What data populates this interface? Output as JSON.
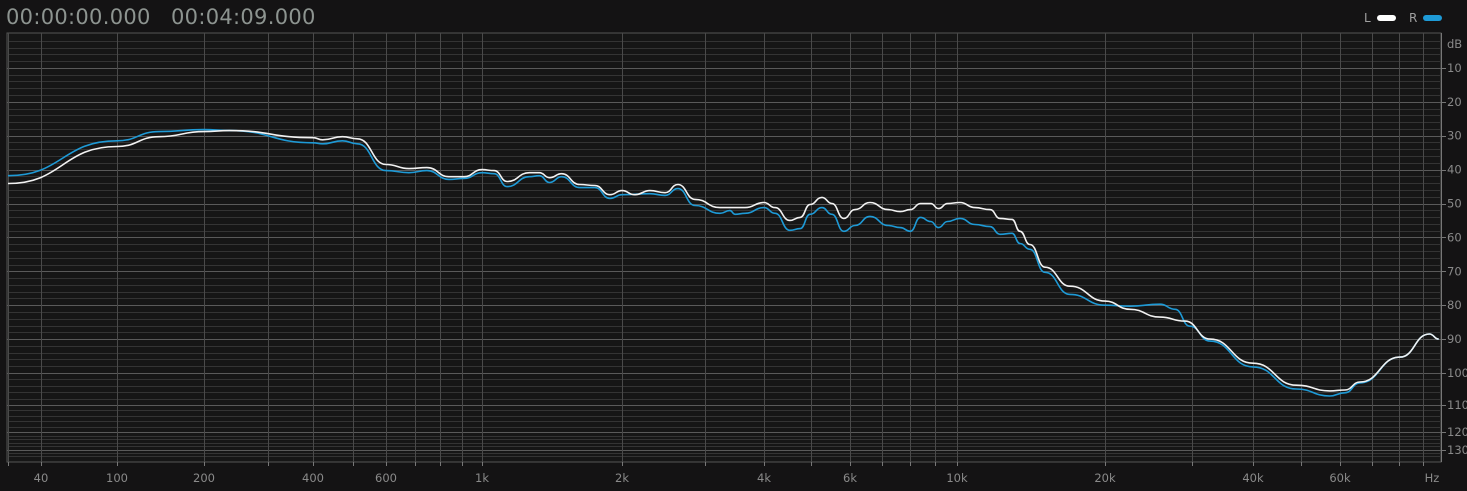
{
  "header": {
    "start_time": "00:00:00.000",
    "end_time": "00:04:09.000"
  },
  "legend": [
    {
      "label": "L",
      "color": "#ffffff"
    },
    {
      "label": "R",
      "color": "#1e9ad6"
    }
  ],
  "chart_data": {
    "type": "line",
    "title": "",
    "xlabel": "Hz",
    "ylabel": "dB",
    "xscale": "log",
    "xlim": [
      20,
      100000
    ],
    "ylim": [
      0,
      135
    ],
    "y_inverted": true,
    "grid": true,
    "legend_position": "top-right",
    "x_ticks": [
      {
        "value": 40,
        "label": "40"
      },
      {
        "value": 100,
        "label": "100"
      },
      {
        "value": 200,
        "label": "200"
      },
      {
        "value": 400,
        "label": "400"
      },
      {
        "value": 600,
        "label": "600"
      },
      {
        "value": 1000,
        "label": "1k"
      },
      {
        "value": 2000,
        "label": "2k"
      },
      {
        "value": 4000,
        "label": "4k"
      },
      {
        "value": 6000,
        "label": "6k"
      },
      {
        "value": 10000,
        "label": "10k"
      },
      {
        "value": 20000,
        "label": "20k"
      },
      {
        "value": 40000,
        "label": "40k"
      },
      {
        "value": 60000,
        "label": "60k"
      }
    ],
    "y_ticks": [
      {
        "value": 0,
        "label": "dB"
      },
      {
        "value": 10,
        "label": "10"
      },
      {
        "value": 20,
        "label": "20"
      },
      {
        "value": 30,
        "label": "30"
      },
      {
        "value": 40,
        "label": "40"
      },
      {
        "value": 50,
        "label": "50"
      },
      {
        "value": 60,
        "label": "60"
      },
      {
        "value": 70,
        "label": "70"
      },
      {
        "value": 80,
        "label": "80"
      },
      {
        "value": 90,
        "label": "90"
      },
      {
        "value": 100,
        "label": "100"
      },
      {
        "value": 110,
        "label": "110"
      },
      {
        "value": 120,
        "label": "120"
      },
      {
        "value": 130,
        "label": "130"
      }
    ],
    "series": [
      {
        "name": "L",
        "color": "#f2f2f2",
        "points": [
          [
            20,
            44.1
          ],
          [
            100,
            33.2
          ],
          [
            140,
            30.3
          ],
          [
            200,
            28.8
          ],
          [
            235,
            28.5
          ],
          [
            400,
            30.6
          ],
          [
            422,
            31.2
          ],
          [
            471,
            30.3
          ],
          [
            512,
            30.9
          ],
          [
            600,
            38.5
          ],
          [
            678,
            39.7
          ],
          [
            746,
            39.4
          ],
          [
            839,
            42.1
          ],
          [
            909,
            42.1
          ],
          [
            1000,
            40
          ],
          [
            1062,
            40.3
          ],
          [
            1133,
            43.5
          ],
          [
            1264,
            40.9
          ],
          [
            1329,
            40.9
          ],
          [
            1397,
            42.4
          ],
          [
            1483,
            41.2
          ],
          [
            1622,
            44.4
          ],
          [
            1748,
            44.7
          ],
          [
            1884,
            47.4
          ],
          [
            2000,
            46.2
          ],
          [
            2129,
            47.4
          ],
          [
            2292,
            46.2
          ],
          [
            2468,
            46.8
          ],
          [
            2628,
            44.4
          ],
          [
            2856,
            48.8
          ],
          [
            3227,
            51.2
          ],
          [
            3645,
            51.2
          ],
          [
            4000,
            49.7
          ],
          [
            4213,
            51.2
          ],
          [
            4519,
            55
          ],
          [
            4744,
            54.1
          ],
          [
            4969,
            50.3
          ],
          [
            5258,
            48.2
          ],
          [
            5509,
            50
          ],
          [
            5826,
            54.4
          ],
          [
            6144,
            51.8
          ],
          [
            6600,
            49.7
          ],
          [
            7196,
            51.8
          ],
          [
            7624,
            52.4
          ],
          [
            8006,
            51.8
          ],
          [
            8400,
            50
          ],
          [
            8820,
            50
          ],
          [
            9154,
            51.5
          ],
          [
            9556,
            50
          ],
          [
            10140,
            49.7
          ],
          [
            10880,
            51.2
          ],
          [
            11670,
            51.8
          ],
          [
            12230,
            54.4
          ],
          [
            12940,
            54.7
          ],
          [
            13430,
            58.2
          ],
          [
            14070,
            62.1
          ],
          [
            15100,
            68.8
          ],
          [
            16980,
            74.4
          ],
          [
            20000,
            78.8
          ],
          [
            22490,
            81.2
          ],
          [
            25880,
            83.5
          ],
          [
            29080,
            84.7
          ],
          [
            32700,
            90
          ],
          [
            40000,
            97.1
          ],
          [
            49000,
            103.8
          ],
          [
            57200,
            105.6
          ],
          [
            61460,
            105.3
          ],
          [
            66100,
            102.8
          ],
          [
            80300,
            95.3
          ],
          [
            92700,
            88.5
          ],
          [
            97000,
            90
          ]
        ]
      },
      {
        "name": "R",
        "color": "#1e9ad6",
        "points": [
          [
            20,
            41.8
          ],
          [
            100,
            31.5
          ],
          [
            140,
            28.8
          ],
          [
            200,
            28.2
          ],
          [
            235,
            28.5
          ],
          [
            400,
            32.1
          ],
          [
            422,
            32.4
          ],
          [
            471,
            31.5
          ],
          [
            512,
            32.4
          ],
          [
            600,
            40.3
          ],
          [
            678,
            40.9
          ],
          [
            746,
            40.3
          ],
          [
            839,
            42.9
          ],
          [
            909,
            42.6
          ],
          [
            1000,
            40.9
          ],
          [
            1062,
            41.2
          ],
          [
            1133,
            45
          ],
          [
            1264,
            42.1
          ],
          [
            1329,
            41.8
          ],
          [
            1397,
            43.8
          ],
          [
            1483,
            42.1
          ],
          [
            1622,
            45.3
          ],
          [
            1748,
            45.3
          ],
          [
            1884,
            48.5
          ],
          [
            2000,
            47.4
          ],
          [
            2292,
            47.1
          ],
          [
            2468,
            47.6
          ],
          [
            2628,
            45.6
          ],
          [
            2856,
            50.6
          ],
          [
            3227,
            52.9
          ],
          [
            3387,
            52.1
          ],
          [
            3472,
            53.2
          ],
          [
            3645,
            52.9
          ],
          [
            4000,
            51.2
          ],
          [
            4213,
            52.9
          ],
          [
            4519,
            57.9
          ],
          [
            4744,
            57.4
          ],
          [
            4969,
            53.2
          ],
          [
            5258,
            51.2
          ],
          [
            5509,
            53.2
          ],
          [
            5826,
            58.2
          ],
          [
            6144,
            56.5
          ],
          [
            6600,
            53.8
          ],
          [
            7196,
            56.5
          ],
          [
            7624,
            57.1
          ],
          [
            8006,
            58.2
          ],
          [
            8400,
            54.1
          ],
          [
            8820,
            55.3
          ],
          [
            9154,
            57.1
          ],
          [
            9556,
            55.3
          ],
          [
            10140,
            54.4
          ],
          [
            10880,
            56.2
          ],
          [
            11670,
            56.8
          ],
          [
            12230,
            59.1
          ],
          [
            12940,
            58.8
          ],
          [
            13430,
            61.8
          ],
          [
            14070,
            63.5
          ],
          [
            15100,
            70.3
          ],
          [
            16980,
            76.8
          ],
          [
            20000,
            80
          ],
          [
            22490,
            80.3
          ],
          [
            25880,
            79.7
          ],
          [
            27760,
            81.2
          ],
          [
            29770,
            86.2
          ],
          [
            32700,
            90.6
          ],
          [
            40000,
            98.2
          ],
          [
            49000,
            105
          ],
          [
            57200,
            107.2
          ],
          [
            61460,
            106.2
          ],
          [
            66100,
            103.1
          ],
          [
            80300,
            95.3
          ],
          [
            92700,
            88.5
          ],
          [
            97000,
            90
          ]
        ]
      }
    ]
  }
}
